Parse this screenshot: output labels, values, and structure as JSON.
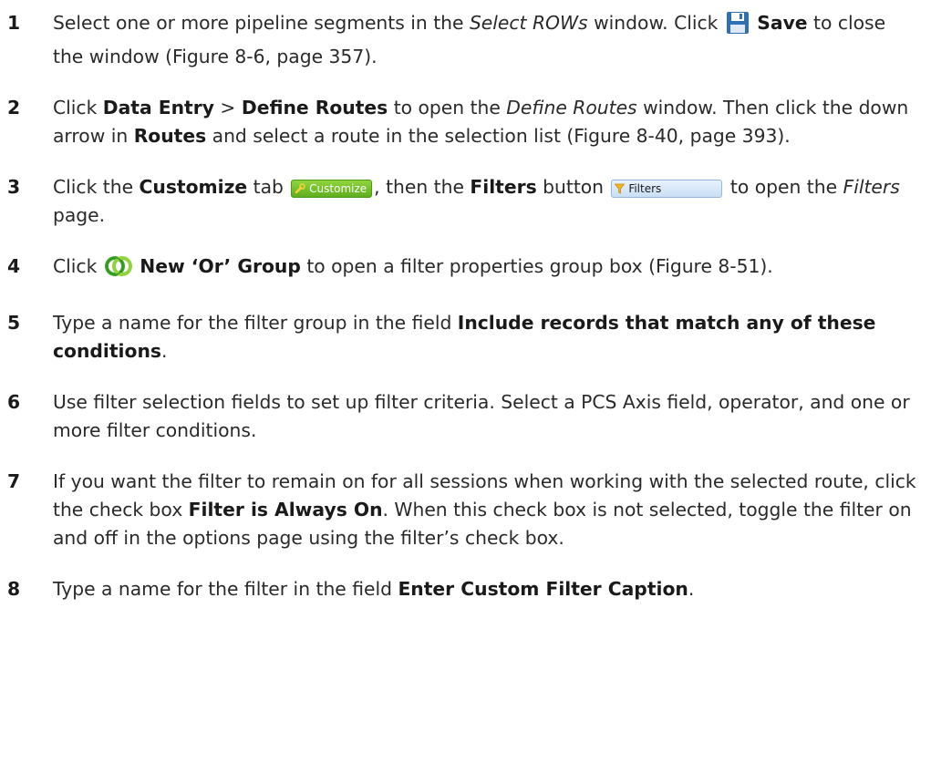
{
  "steps": [
    {
      "number": "1",
      "t1": "Select one or more pipeline segments in the ",
      "i1": "Select ROWs",
      "t2": " window. Click ",
      "icon": "save-disk-icon",
      "b1": "Save",
      "t3": " to close the window (Figure 8-6, page 357)."
    },
    {
      "number": "2",
      "t1": "Click ",
      "b1": "Data Entry",
      "t2": " > ",
      "b2": "Define Routes",
      "t3": " to open the ",
      "i1": "Define Routes",
      "t4": " window. Then click the down arrow in ",
      "b3": "Routes",
      "t5": " and select a route in the selection list (Figure 8-40, page 393)."
    },
    {
      "number": "3",
      "t1": "Click the ",
      "b1": "Customize",
      "t2": " tab ",
      "badge1": "Customize",
      "t3": ", then the ",
      "b2": "Filters",
      "t4": " button ",
      "badge2": "Filters",
      "t5": " to open the ",
      "i1": "Filters",
      "t6": " page."
    },
    {
      "number": "4",
      "t1": "Click ",
      "icon": "or-group-icon",
      "b1": "New ‘Or’ Group",
      "t2": " to open a filter properties group box (Figure 8-51)."
    },
    {
      "number": "5",
      "t1": "Type a name for the filter group in the field ",
      "b1": "Include records that match any of these conditions",
      "t2": "."
    },
    {
      "number": "6",
      "t1": "Use filter selection fields to set up filter criteria. Select a PCS Axis field, operator, and one or more filter conditions."
    },
    {
      "number": "7",
      "t1": "If you want the filter to remain on for all sessions when working with the selected route, click the check box ",
      "b1": "Filter is Always On",
      "t2": ". When this check box is not selected, toggle the filter on and off in the options page using the filter’s check box."
    },
    {
      "number": "8",
      "t1": "Type a name for the filter in the field ",
      "b1": "Enter Custom Filter Caption",
      "t2": "."
    }
  ],
  "colors": {
    "customize_green": "#6cbf26",
    "filters_blue": "#d6e8f9",
    "save_blue": "#2f6fb4",
    "or_green": "#3fa82a"
  }
}
